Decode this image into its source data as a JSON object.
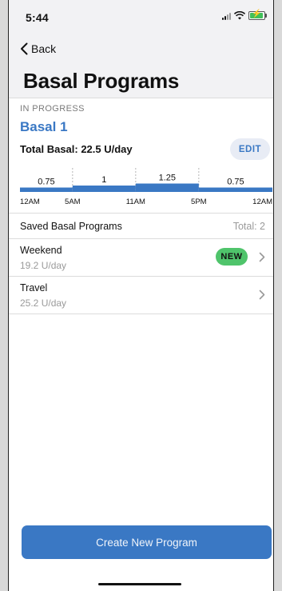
{
  "status": {
    "time": "5:44"
  },
  "nav": {
    "back_label": "Back",
    "title": "Basal Programs"
  },
  "current": {
    "section_label": "IN PROGRESS",
    "program_name": "Basal 1",
    "total_basal": "Total Basal: 22.5 U/day",
    "edit_label": "EDIT"
  },
  "chart_data": {
    "type": "step",
    "x_ticks": [
      "12AM",
      "5AM",
      "11AM",
      "5PM",
      "12AM"
    ],
    "segments": [
      {
        "start_hour": 0,
        "end_hour": 5,
        "rate": 0.75,
        "label": "0.75"
      },
      {
        "start_hour": 5,
        "end_hour": 11,
        "rate": 1,
        "label": "1"
      },
      {
        "start_hour": 11,
        "end_hour": 17,
        "rate": 1.25,
        "label": "1.25"
      },
      {
        "start_hour": 17,
        "end_hour": 24,
        "rate": 0.75,
        "label": "0.75"
      }
    ],
    "color": "#3a78c4"
  },
  "saved": {
    "title": "Saved Basal Programs",
    "total": "Total: 2",
    "items": [
      {
        "name": "Weekend",
        "rate": "19.2 U/day",
        "badge": "NEW"
      },
      {
        "name": "Travel",
        "rate": "25.2 U/day"
      }
    ]
  },
  "create_label": "Create New Program",
  "colors": {
    "accent": "#3a78c4",
    "badge_green": "#4fc46b"
  }
}
